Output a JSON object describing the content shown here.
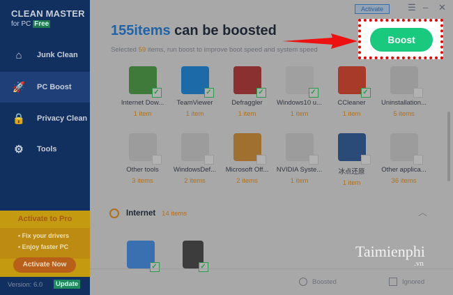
{
  "app": {
    "name": "CLEAN MASTER",
    "sub": "for PC",
    "edition": "Free"
  },
  "sidebar": {
    "items": [
      {
        "label": "Junk Clean",
        "icon": "broom-icon"
      },
      {
        "label": "PC Boost",
        "icon": "rocket-icon"
      },
      {
        "label": "Privacy Clean",
        "icon": "lock-icon"
      },
      {
        "label": "Tools",
        "icon": "gear-icon"
      }
    ],
    "promo": {
      "title": "Activate to Pro",
      "points": [
        "• Fix your drivers",
        "• Enjoy faster PC"
      ],
      "button": "Activate Now"
    },
    "version": "Version: 6.0",
    "update": "Update"
  },
  "header": {
    "activate": "Activate",
    "count": "155items",
    "title_rest": " can be boosted",
    "sub_pre": "Selected ",
    "sub_num": "59",
    "sub_post": " items, run boost to improve boot speed and system speed",
    "boost": "Boost"
  },
  "grid": [
    {
      "name": "Internet Dow...",
      "count": "1 item",
      "checked": true,
      "color": "#3f7a3a"
    },
    {
      "name": "TeamViewer",
      "count": "1 item",
      "checked": true,
      "color": "#1d6aa8"
    },
    {
      "name": "Defraggler",
      "count": "1 item",
      "checked": true,
      "color": "#8a3030"
    },
    {
      "name": "Windows10 u...",
      "count": "1 item",
      "checked": true,
      "color": "#a0a0a0"
    },
    {
      "name": "CCleaner",
      "count": "1 item",
      "checked": true,
      "color": "#a83a2a"
    },
    {
      "name": "Uninstallation...",
      "count": "5 items",
      "checked": false,
      "color": "#9a9a9a"
    },
    {
      "name": "Other tools",
      "count": "3 items",
      "checked": false,
      "color": "#9c9c9c"
    },
    {
      "name": "WindowsDef...",
      "count": "2 items",
      "checked": false,
      "color": "#9c9c9c"
    },
    {
      "name": "Microsoft Off...",
      "count": "2 items",
      "checked": false,
      "color": "#a07030"
    },
    {
      "name": "NVIDIA Syste...",
      "count": "1 item",
      "checked": false,
      "color": "#9c9c9c"
    },
    {
      "name": "冰点还原",
      "count": "1 item",
      "checked": false,
      "color": "#2a4a78"
    },
    {
      "name": "Other applica...",
      "count": "36 items",
      "checked": false,
      "color": "#9c9c9c"
    }
  ],
  "internet": {
    "label": "Internet",
    "count": "14 items",
    "items": [
      {
        "checked": true,
        "color": "#3a70b0"
      },
      {
        "checked": true,
        "color": "#3c3c3c"
      }
    ]
  },
  "footer": {
    "boosted": "Boosted",
    "ignored": "Ignored"
  },
  "watermark": {
    "text": "Taimienphi",
    "tld": ".vn"
  }
}
